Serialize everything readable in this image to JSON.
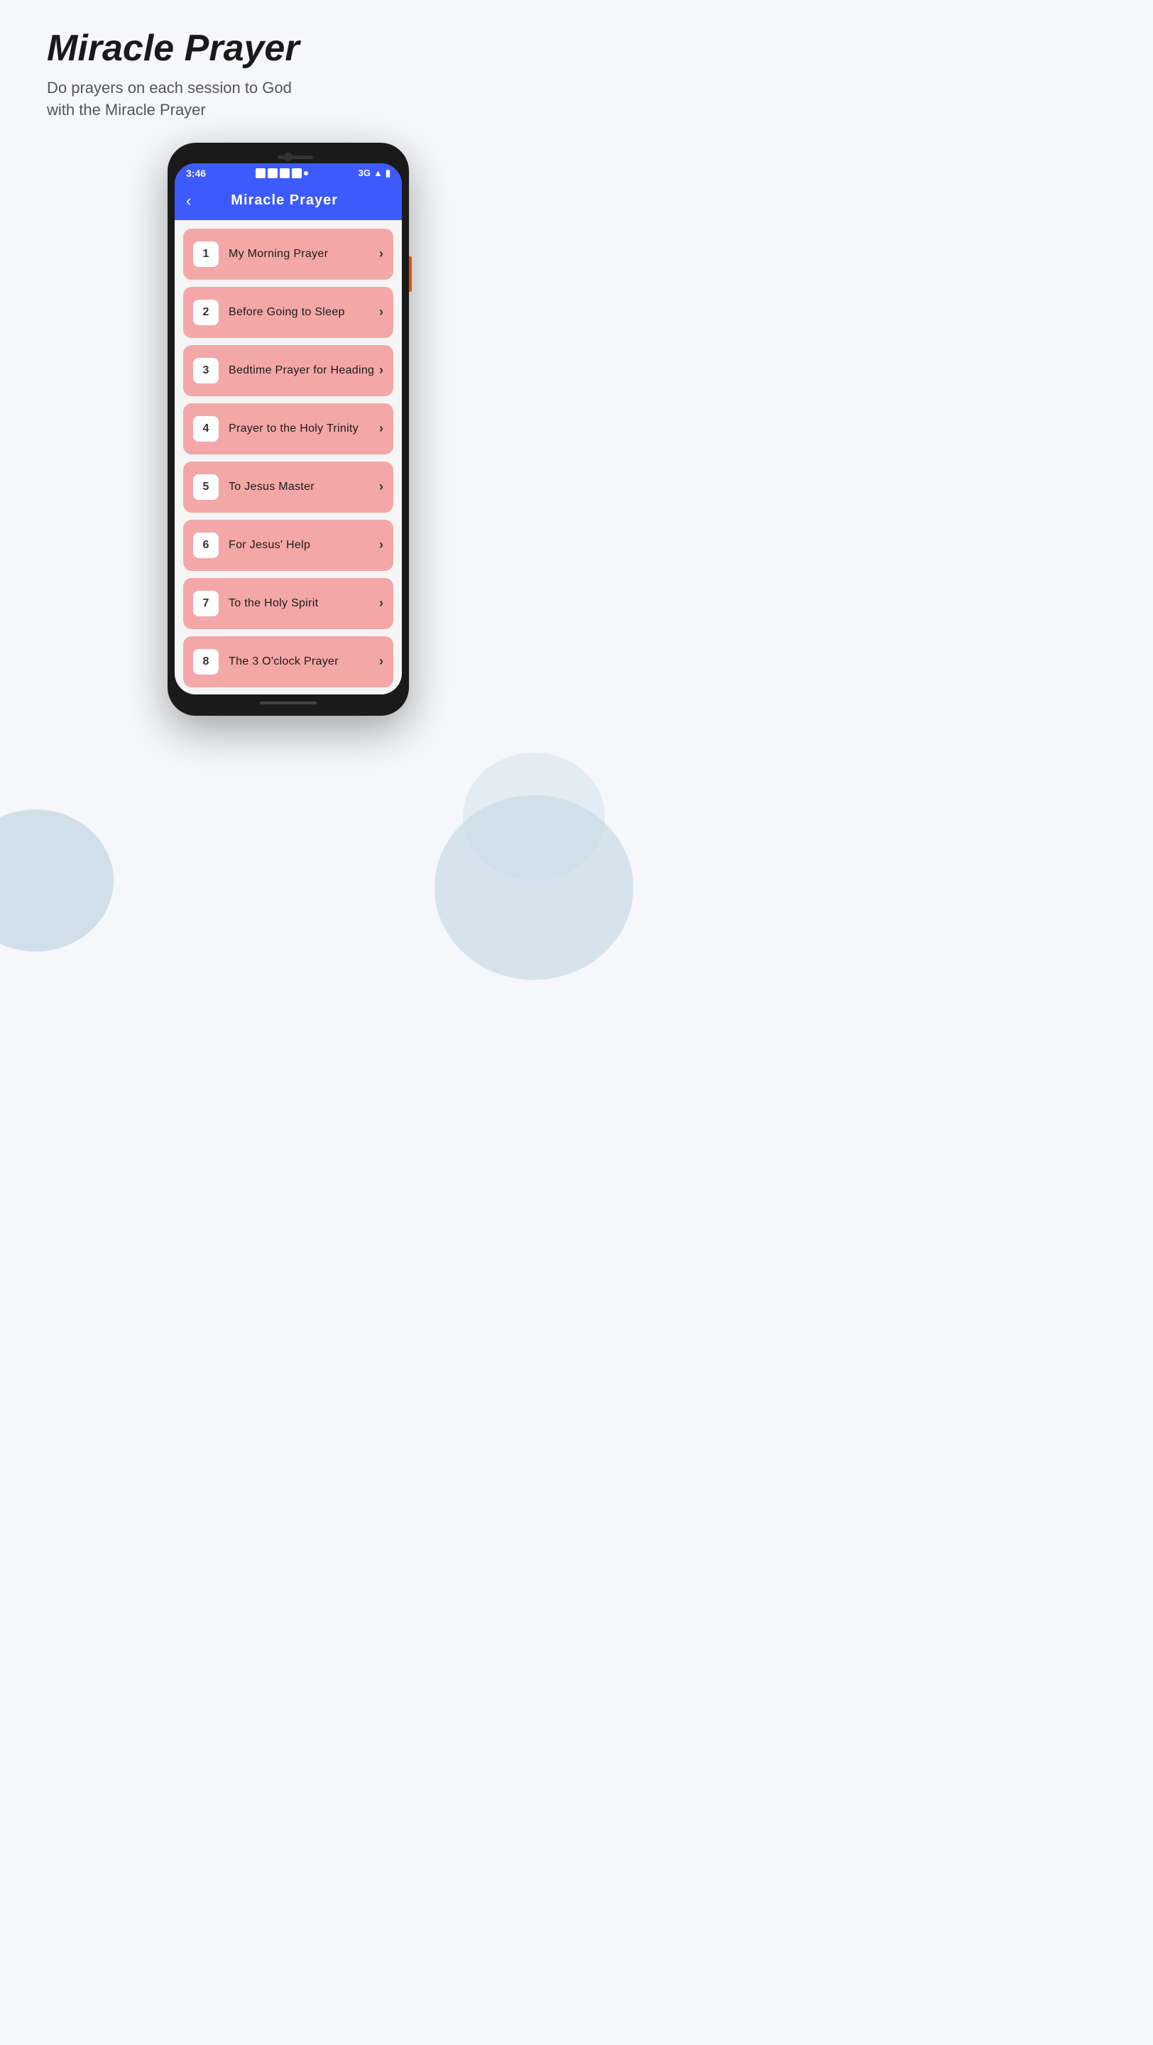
{
  "page": {
    "title": "Miracle Prayer",
    "subtitle": "Do prayers on each session to God\nwith the Miracle Prayer"
  },
  "app": {
    "header_title": "Miracle  Prayer",
    "back_label": "‹"
  },
  "status_bar": {
    "time": "3:46",
    "network": "3G",
    "signal": "▲"
  },
  "prayers": [
    {
      "id": 1,
      "label": "My Morning Prayer"
    },
    {
      "id": 2,
      "label": "Before  Going to Sleep"
    },
    {
      "id": 3,
      "label": "Bedtime Prayer for Heading"
    },
    {
      "id": 4,
      "label": "Prayer to the Holy Trinity"
    },
    {
      "id": 5,
      "label": "To Jesus Master"
    },
    {
      "id": 6,
      "label": "For Jesus' Help"
    },
    {
      "id": 7,
      "label": "To the Holy Spirit"
    },
    {
      "id": 8,
      "label": "The 3 O'clock Prayer"
    }
  ]
}
